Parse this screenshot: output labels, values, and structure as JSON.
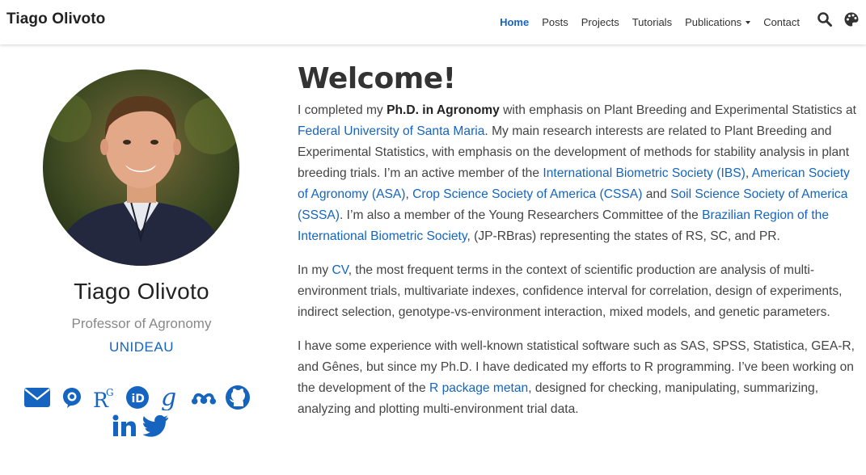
{
  "colors": {
    "accent": "#1565c0",
    "text": "#444"
  },
  "nav": {
    "brand": "Tiago Olivoto",
    "items": [
      {
        "label": "Home",
        "active": true
      },
      {
        "label": "Posts"
      },
      {
        "label": "Projects"
      },
      {
        "label": "Tutorials"
      },
      {
        "label": "Publications",
        "dropdown": true
      },
      {
        "label": "Contact"
      }
    ],
    "icons": [
      "search-icon",
      "palette-icon"
    ]
  },
  "profile": {
    "name": "Tiago Olivoto",
    "role": "Professor of Agronomy",
    "organization": "UNIDEAU",
    "social_icons": [
      "envelope-icon",
      "keybase-icon",
      "researchgate-icon",
      "orcid-icon",
      "google-scholar-icon",
      "mendeley-icon",
      "github-icon",
      "linkedin-icon",
      "twitter-icon"
    ]
  },
  "content": {
    "title": "Welcome!",
    "p1": {
      "t1": "I completed my ",
      "b1": "Ph.D. in Agronomy",
      "t2": " with emphasis on Plant Breeding and Experimental Statistics at ",
      "l1": "Federal University of Santa Maria",
      "t3": ". My main research interests are related to Plant Breeding and Experimental Statistics, with emphasis on the development of methods for stability analysis in plant breeding trials. I’m an active member of the ",
      "l2": "International Biometric Society (IBS)",
      "t4": ", ",
      "l3": "American Society of Agronomy (ASA)",
      "t5": ", ",
      "l4": "Crop Science Society of America (CSSA)",
      "t6": " and ",
      "l5": "Soil Science Society of America (SSSA)",
      "t7": ". I’m also a member of the Young Researchers Committee of the ",
      "l6": "Brazilian Region of the International Biometric Society",
      "t8": ", (JP-RBras) representing the states of RS, SC, and PR."
    },
    "p2": {
      "t1": "In my ",
      "l1": "CV",
      "t2": ", the most frequent terms in the context of scientific production are analysis of multi-environment trials, multivariate indexes, confidence interval for correlation, design of experiments, indirect selection, genotype-vs-environment interaction, mixed models, and genetic parameters."
    },
    "p3": {
      "t1": "I have some experience with well-known statistical software such as SAS, SPSS, Statistica, GEA-R, and Gênes, but since my Ph.D. I have dedicated my efforts to R programming. I’ve been working on the development of the ",
      "l1": "R package metan",
      "t2": ", designed for checking, manipulating, summarizing, analyzing and plotting multi-environment trial data."
    }
  }
}
